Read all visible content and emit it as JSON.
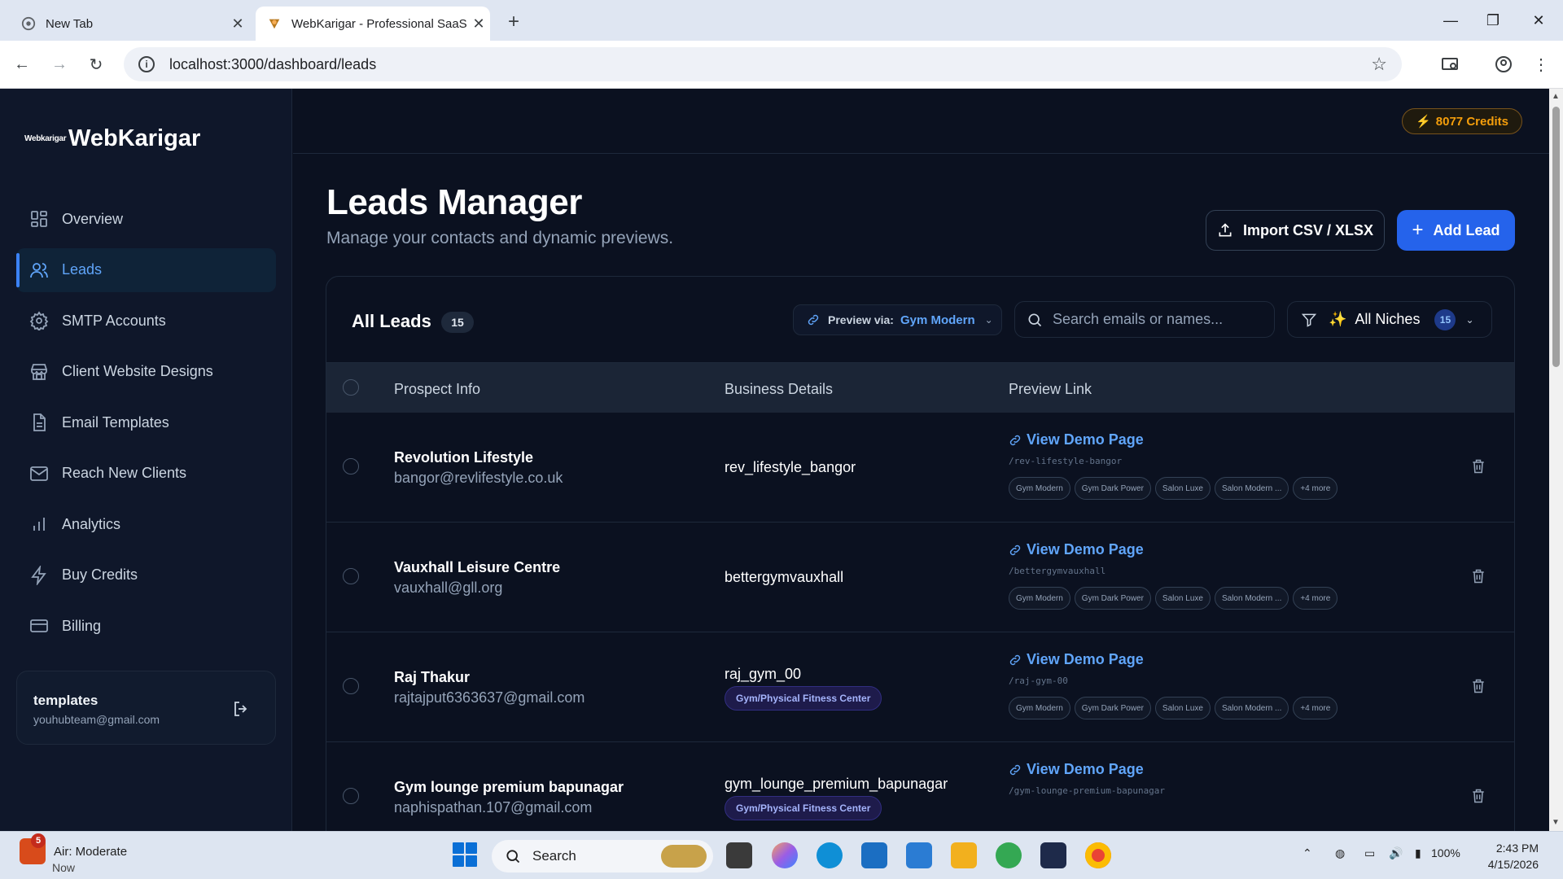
{
  "browser": {
    "tabs": [
      {
        "title": "New Tab",
        "active": false
      },
      {
        "title": "WebKarigar - Professional SaaS",
        "active": true
      }
    ],
    "url": "localhost:3000/dashboard/leads"
  },
  "app": {
    "brand": {
      "logo_text": "Webkarigar",
      "name": "WebKarigar"
    },
    "credits": "8077 Credits",
    "nav": [
      {
        "label": "Overview",
        "icon": "grid-icon",
        "active": false
      },
      {
        "label": "Leads",
        "icon": "users-icon",
        "active": true
      },
      {
        "label": "SMTP Accounts",
        "icon": "gear-icon",
        "active": false
      },
      {
        "label": "Client Website Designs",
        "icon": "store-icon",
        "active": false
      },
      {
        "label": "Email Templates",
        "icon": "document-icon",
        "active": false
      },
      {
        "label": "Reach New Clients",
        "icon": "mail-icon",
        "active": false
      },
      {
        "label": "Analytics",
        "icon": "bar-chart-icon",
        "active": false
      },
      {
        "label": "Buy Credits",
        "icon": "bolt-icon",
        "active": false
      },
      {
        "label": "Billing",
        "icon": "credit-card-icon",
        "active": false
      }
    ],
    "user": {
      "name": "templates",
      "email": "youhubteam@gmail.com"
    }
  },
  "page": {
    "title": "Leads Manager",
    "subtitle": "Manage your contacts and dynamic previews.",
    "import_label": "Import CSV / XLSX",
    "add_label": "Add Lead"
  },
  "leads_card": {
    "title": "All Leads",
    "count": "15",
    "preview_label": "Preview via:",
    "preview_value": "Gym Modern",
    "search_placeholder": "Search emails or names...",
    "niche_label": "All Niches",
    "niche_count": "15",
    "columns": [
      "Prospect Info",
      "Business Details",
      "Preview Link"
    ],
    "demo_label": "View Demo Page",
    "chips": [
      "Gym Modern",
      "Gym Dark Power",
      "Salon Luxe",
      "Salon Modern ...",
      "+4 more"
    ],
    "rows": [
      {
        "name": "Revolution Lifestyle",
        "email": "bangor@revlifestyle.co.uk",
        "business": "rev_lifestyle_bangor",
        "tag": "",
        "slug": "/rev-lifestyle-bangor"
      },
      {
        "name": "Vauxhall Leisure Centre",
        "email": "vauxhall@gll.org",
        "business": "bettergymvauxhall",
        "tag": "",
        "slug": "/bettergymvauxhall"
      },
      {
        "name": "Raj Thakur",
        "email": "rajtajput6363637@gmail.com",
        "business": "raj_gym_00",
        "tag": "Gym/Physical Fitness Center",
        "slug": "/raj-gym-00"
      },
      {
        "name": "Gym lounge premium bapunagar",
        "email": "naphispathan.107@gmail.com",
        "business": "gym_lounge_premium_bapunagar",
        "tag": "Gym/Physical Fitness Center",
        "slug": "/gym-lounge-premium-bapunagar"
      }
    ]
  },
  "taskbar": {
    "weather_title": "Air: Moderate",
    "weather_sub": "Now",
    "weather_badge": "5",
    "search_label": "Search",
    "battery": "100%",
    "time": "2:43 PM",
    "date": "4/15/2026"
  }
}
